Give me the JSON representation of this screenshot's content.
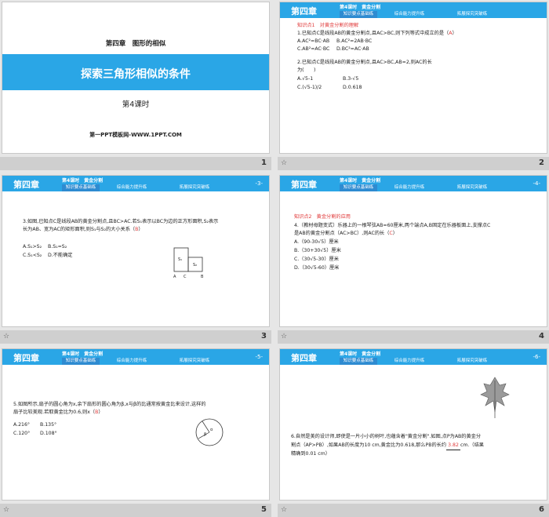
{
  "slides": [
    {
      "number": "1",
      "chapter": "第四章　图形的相似",
      "title": "探索三角形相似的条件",
      "lesson": "第4课时",
      "site": "第一PPT模板网-WWW.1PPT.COM"
    },
    {
      "number": "2",
      "header": {
        "chapter": "第四章",
        "sub": "第4课时　黄金分割",
        "tab1": "知识要点基础练",
        "tab2": "综合能力提升练",
        "tab3": "拓展探究突破练",
        "page": ""
      },
      "point": "知识点1　对黄金分割的理解",
      "q1": "1.已知点C是线段AB的黄金分割点,且AC>BC,则下列等式中成立的是（",
      "q1_ans": "A",
      "q1_close": "）",
      "q1_a": "A.AC²=BC·AB",
      "q1_b": "B.AC²=2AB·BC",
      "q1_c": "C.AB²=AC·BC",
      "q1_d": "D.BC²=AC·AB",
      "q2": "2.已知点C是线段AB的黄金分割点,且AC>BC,AB=2,则AC的长",
      "q2_line2": "为(　　)",
      "q2_a": "A.√5-1",
      "q2_b": "B.3-√5",
      "q2_c": "C.(√5-1)/2",
      "q2_d": "D.0.618"
    },
    {
      "number": "3",
      "header": {
        "chapter": "第四章",
        "sub": "第4课时　黄金分割",
        "tab1": "知识要点基础练",
        "tab2": "综合能力提升练",
        "tab3": "拓展探究突破练",
        "page": "-3-"
      },
      "q3": "3.如图,已知点C是线段AB的黄金分割点,且BC>AC.若S₁表示以BC为边的正方形面积,S₂表示",
      "q3_line2": "长为AB、宽为AC的矩形面积,则S₁与S₂的大小关系（",
      "q3_ans": "B",
      "q3_close": "）",
      "q3_a": "A.S₁>S₂",
      "q3_b": "B.S₁=S₂",
      "q3_c": "C.S₁<S₂",
      "q3_d": "D.不能确定",
      "fig_s1": "S₁",
      "fig_s2": "S₂",
      "fig_a": "A",
      "fig_c": "C",
      "fig_b": "B"
    },
    {
      "number": "4",
      "header": {
        "chapter": "第四章",
        "sub": "第4课时　黄金分割",
        "tab1": "知识要点基础练",
        "tab2": "综合能力提升练",
        "tab3": "拓展探究突破练",
        "page": "-4-"
      },
      "point": "知识点2　黄金分割的应用",
      "q4": "4.（教材母题变式）乐器上的一根琴弦AB=60厘米,两个端点A,B固定在乐器板面上,支撑点C",
      "q4_line2": "是AB的黄金分割点（AC>BC）,则AC的长（",
      "q4_ans": "C",
      "q4_close": "）",
      "q4_a": "A.（90-30√5）厘米",
      "q4_b": "B.（30+30√5）厘米",
      "q4_c": "C.（30√5-30）厘米",
      "q4_d": "D.（30√5-60）厘米"
    },
    {
      "number": "5",
      "header": {
        "chapter": "第四章",
        "sub": "第4课时　黄金分割",
        "tab1": "知识要点基础练",
        "tab2": "综合能力提升练",
        "tab3": "拓展探究突破练",
        "page": "-5-"
      },
      "q5": "5.如图所示,扇子的圆心角为x,余下扇形的圆心角为β,x与β的比通常按黄金比来设计,这样的",
      "q5_line2": "扇子比较美观.若取黄金比为0.6,则x（",
      "q5_ans": "B",
      "q5_close": "）",
      "q5_a": "A.216°",
      "q5_b": "B.135°",
      "q5_c": "C.120°",
      "q5_d": "D.108°",
      "fig_alpha": "α",
      "fig_beta": "β"
    },
    {
      "number": "6",
      "header": {
        "chapter": "第四章",
        "sub": "第4课时　黄金分割",
        "tab1": "知识要点基础练",
        "tab2": "综合能力提升练",
        "tab3": "拓展探究突破练",
        "page": "-6-"
      },
      "q6": "6.自然是美的设计师,即使是一片小小的树叶,也蕴含着\"黄金分割\".如图,点P为AB的黄金分",
      "q6_line2": "割点（AP>PB）,如果AB的长度为10 cm,黄金比为0.618,那么PB的长约",
      "q6_ans": "3.82",
      "q6_line2b": "cm.（结果",
      "q6_line3": "精确到0.01 cm）"
    }
  ]
}
